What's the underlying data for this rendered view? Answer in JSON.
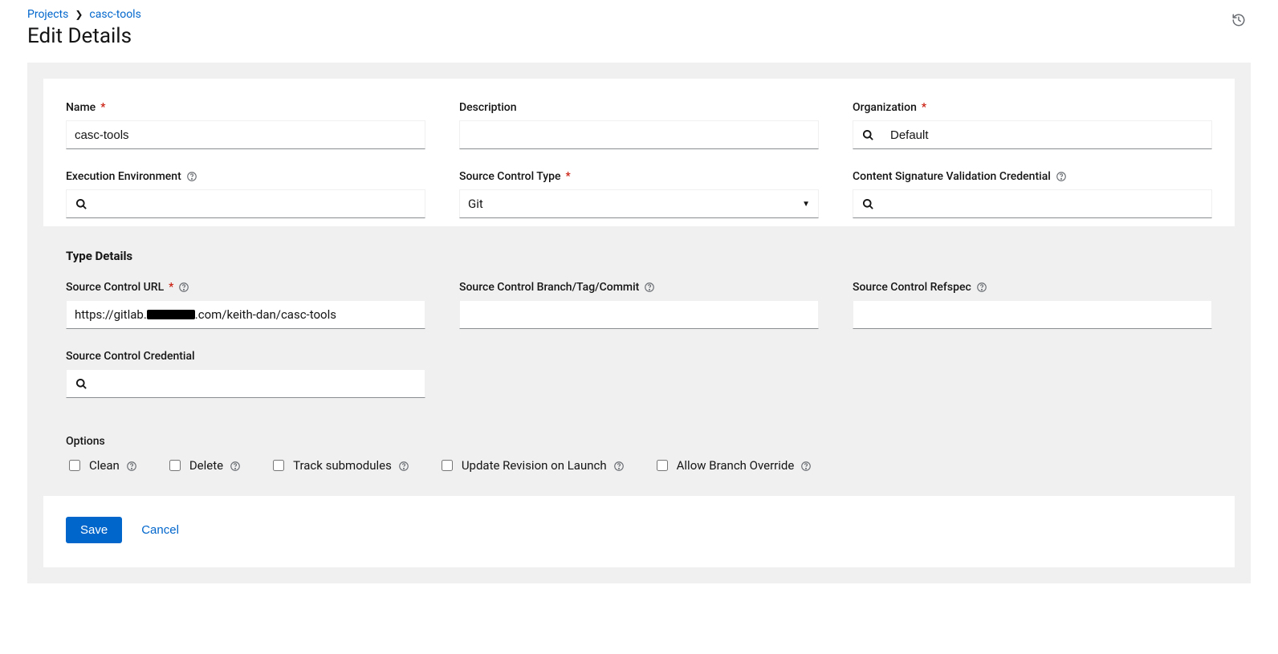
{
  "breadcrumb": {
    "root": "Projects",
    "current": "casc-tools"
  },
  "page_title": "Edit Details",
  "fields": {
    "name": {
      "label": "Name",
      "value": "casc-tools",
      "required": true
    },
    "description": {
      "label": "Description",
      "value": "",
      "required": false
    },
    "organization": {
      "label": "Organization",
      "value": "Default",
      "required": true
    },
    "exec_env": {
      "label": "Execution Environment",
      "value": "",
      "required": false
    },
    "scm_type": {
      "label": "Source Control Type",
      "value": "Git",
      "required": true
    },
    "sig_cred": {
      "label": "Content Signature Validation Credential",
      "value": "",
      "required": false
    }
  },
  "type_details": {
    "heading": "Type Details",
    "scm_url": {
      "label": "Source Control URL",
      "value_prefix": "https://gitlab.",
      "value_suffix": ".com/keith-dan/casc-tools",
      "required": true
    },
    "scm_branch": {
      "label": "Source Control Branch/Tag/Commit",
      "value": "",
      "required": false
    },
    "scm_refspec": {
      "label": "Source Control Refspec",
      "value": "",
      "required": false
    },
    "scm_cred": {
      "label": "Source Control Credential",
      "value": "",
      "required": false
    }
  },
  "options": {
    "heading": "Options",
    "items": [
      {
        "key": "clean",
        "label": "Clean",
        "checked": false
      },
      {
        "key": "delete",
        "label": "Delete",
        "checked": false
      },
      {
        "key": "track_submodules",
        "label": "Track submodules",
        "checked": false
      },
      {
        "key": "update_on_launch",
        "label": "Update Revision on Launch",
        "checked": false
      },
      {
        "key": "allow_branch_override",
        "label": "Allow Branch Override",
        "checked": false
      }
    ]
  },
  "footer": {
    "save": "Save",
    "cancel": "Cancel"
  }
}
